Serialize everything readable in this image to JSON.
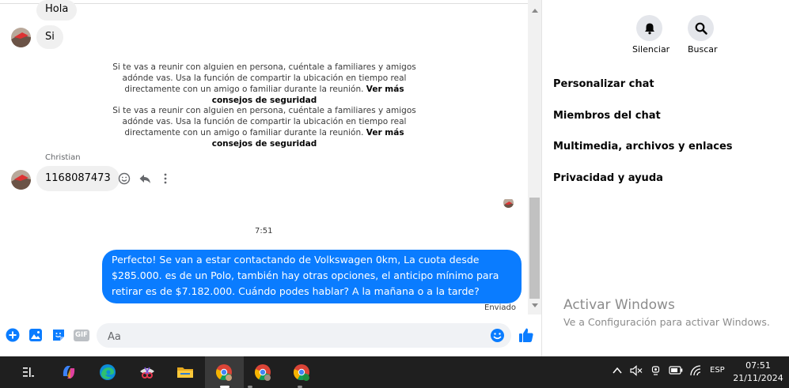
{
  "chat": {
    "messages_in": [
      {
        "text": "Hola"
      },
      {
        "text": "Si"
      }
    ],
    "notices": [
      {
        "text": "Si te vas a reunir con alguien en persona, cuéntale a familiares y amigos adónde vas. Usa la función de compartir la ubicación en tiempo real directamente con un amigo o familiar durante la reunión.",
        "link": "Ver más consejos de seguridad"
      },
      {
        "text": "Si te vas a reunir con alguien en persona, cuéntale a familiares y amigos adónde vas. Usa la función de compartir la ubicación en tiempo real directamente con un amigo o familiar durante la reunión.",
        "link": "Ver más consejos de seguridad"
      }
    ],
    "sender_name": "Christian",
    "phone_message": "1168087473",
    "timestamp": "7:51",
    "outgoing_message": "Perfecto!  Se van a estar contactando de Volkswagen 0km, La cuota desde $285.000. es de un Polo, también hay otras opciones, el anticipo mínimo para retirar es de $7.182.000. Cuándo podes hablar? A la mañana o a la tarde?",
    "sent_status": "Enviado"
  },
  "composer": {
    "placeholder": "Aa",
    "gif_label": "GIF"
  },
  "panel": {
    "mute_label": "Silenciar",
    "search_label": "Buscar",
    "menu": [
      {
        "label": "Personalizar chat"
      },
      {
        "label": "Miembros del chat"
      },
      {
        "label": "Multimedia, archivos y enlaces"
      },
      {
        "label": "Privacidad y ayuda"
      }
    ]
  },
  "watermark": {
    "title": "Activar Windows",
    "subtitle": "Ve a Configuración para activar Windows."
  },
  "taskbar": {
    "language": "ESP",
    "time": "07:51",
    "date": "21/11/2024"
  },
  "colors": {
    "accent": "#0a7cff",
    "bubble_in": "#f0f0f0",
    "taskbar": "#1f1f1f"
  }
}
